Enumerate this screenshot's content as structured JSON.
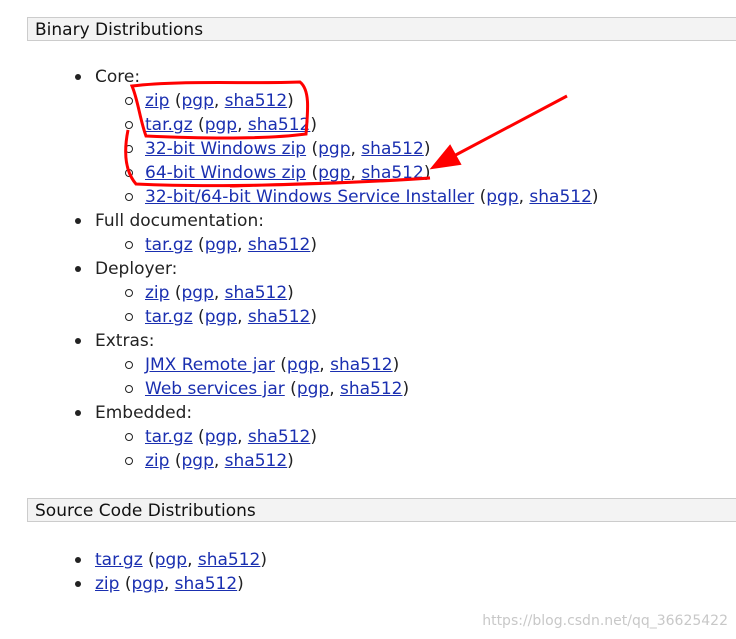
{
  "binary": {
    "header": "Binary Distributions",
    "groups": [
      {
        "label": "Core:",
        "items": [
          {
            "link": "zip",
            "pgp": "pgp",
            "sha": "sha512"
          },
          {
            "link": "tar.gz",
            "pgp": "pgp",
            "sha": "sha512"
          },
          {
            "link": "32-bit Windows zip",
            "pgp": "pgp",
            "sha": "sha512"
          },
          {
            "link": "64-bit Windows zip",
            "pgp": "pgp",
            "sha": "sha512"
          },
          {
            "link": "32-bit/64-bit Windows Service Installer",
            "pgp": "pgp",
            "sha": "sha512"
          }
        ]
      },
      {
        "label": "Full documentation:",
        "items": [
          {
            "link": "tar.gz",
            "pgp": "pgp",
            "sha": "sha512"
          }
        ]
      },
      {
        "label": "Deployer:",
        "items": [
          {
            "link": "zip",
            "pgp": "pgp",
            "sha": "sha512"
          },
          {
            "link": "tar.gz",
            "pgp": "pgp",
            "sha": "sha512"
          }
        ]
      },
      {
        "label": "Extras:",
        "items": [
          {
            "link": "JMX Remote jar",
            "pgp": "pgp",
            "sha": "sha512"
          },
          {
            "link": "Web services jar",
            "pgp": "pgp",
            "sha": "sha512"
          }
        ]
      },
      {
        "label": "Embedded:",
        "items": [
          {
            "link": "tar.gz",
            "pgp": "pgp",
            "sha": "sha512"
          },
          {
            "link": "zip",
            "pgp": "pgp",
            "sha": "sha512"
          }
        ]
      }
    ]
  },
  "source": {
    "header": "Source Code Distributions",
    "items": [
      {
        "link": "tar.gz",
        "pgp": "pgp",
        "sha": "sha512"
      },
      {
        "link": "zip",
        "pgp": "pgp",
        "sha": "sha512"
      }
    ]
  },
  "watermark": "https://blog.csdn.net/qq_36625422",
  "colors": {
    "link": "#1a2fb0",
    "annotation": "#ff0000",
    "header_bg": "#f3f3f3"
  }
}
